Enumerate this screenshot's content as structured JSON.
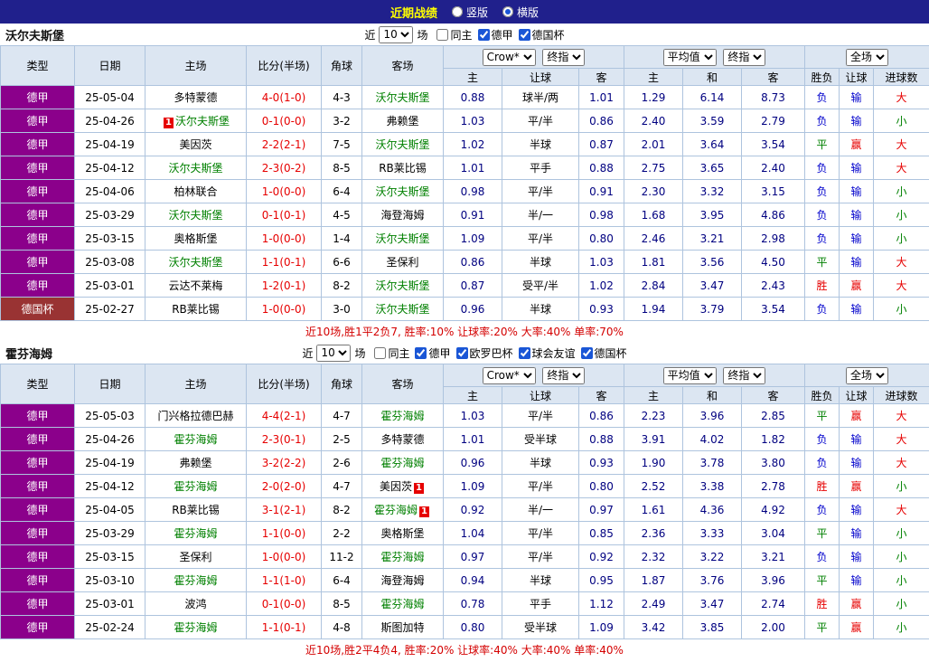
{
  "topbar": {
    "title": "近期战绩",
    "radios": [
      {
        "label": "竖版",
        "selected": false
      },
      {
        "label": "横版",
        "selected": true
      }
    ]
  },
  "colors": {
    "title_bar_bg": "#20208c",
    "title_text": "#ffff00",
    "header_bg": "#dce6f2",
    "border": "#aec4de",
    "league": {
      "德甲": "#8b008b",
      "德国杯": "#993333"
    },
    "focus_team": "#008000",
    "score_text": "#e60000",
    "odds_text": "#000080",
    "result": {
      "win": "#e60000",
      "draw": "#008000",
      "lose": "#0000cc"
    },
    "summary_text": "#d40000",
    "badge_bg": "#e60000"
  },
  "result_map": {
    "胜": "win",
    "平": "draw",
    "负": "lose",
    "赢": "win",
    "输": "lose",
    "大": "win",
    "小": "draw"
  },
  "filter_labels": {
    "prefix": "近",
    "suffix": "场"
  },
  "table_header": {
    "cols": [
      "类型",
      "日期",
      "主场",
      "比分(半场)",
      "角球",
      "客场"
    ],
    "odds_company": "Crow*",
    "odds_stage": "终指",
    "avg_label": "平均值",
    "avg_stage": "终指",
    "scope": "全场",
    "sub_cols": [
      "主",
      "让球",
      "客",
      "主",
      "和",
      "客",
      "胜负",
      "让球",
      "进球数"
    ]
  },
  "sections": [
    {
      "team": "沃尔夫斯堡",
      "filter": {
        "count": "10",
        "checkboxes": [
          {
            "label": "同主",
            "checked": false
          },
          {
            "label": "德甲",
            "checked": true
          },
          {
            "label": "德国杯",
            "checked": true
          }
        ]
      },
      "rows": [
        {
          "league": "德甲",
          "date": "25-05-04",
          "home": "多特蒙德",
          "score": "4-0(1-0)",
          "corner": "4-3",
          "away": "沃尔夫斯堡",
          "away_focus": true,
          "odds_home": "0.88",
          "handicap": "球半/两",
          "odds_away": "1.01",
          "avg_home": "1.29",
          "avg_draw": "6.14",
          "avg_away": "8.73",
          "result": "负",
          "handicap_result": "输",
          "goals": "大"
        },
        {
          "league": "德甲",
          "date": "25-04-26",
          "home": "沃尔夫斯堡",
          "home_focus": true,
          "home_badge": "1",
          "home_badge_pos": "before",
          "score": "0-1(0-0)",
          "corner": "3-2",
          "away": "弗赖堡",
          "odds_home": "1.03",
          "handicap": "平/半",
          "odds_away": "0.86",
          "avg_home": "2.40",
          "avg_draw": "3.59",
          "avg_away": "2.79",
          "result": "负",
          "handicap_result": "输",
          "goals": "小"
        },
        {
          "league": "德甲",
          "date": "25-04-19",
          "home": "美因茨",
          "score": "2-2(2-1)",
          "corner": "7-5",
          "away": "沃尔夫斯堡",
          "away_focus": true,
          "odds_home": "1.02",
          "handicap": "半球",
          "odds_away": "0.87",
          "avg_home": "2.01",
          "avg_draw": "3.64",
          "avg_away": "3.54",
          "result": "平",
          "handicap_result": "赢",
          "goals": "大"
        },
        {
          "league": "德甲",
          "date": "25-04-12",
          "home": "沃尔夫斯堡",
          "home_focus": true,
          "score": "2-3(0-2)",
          "corner": "8-5",
          "away": "RB莱比锡",
          "odds_home": "1.01",
          "handicap": "平手",
          "odds_away": "0.88",
          "avg_home": "2.75",
          "avg_draw": "3.65",
          "avg_away": "2.40",
          "result": "负",
          "handicap_result": "输",
          "goals": "大"
        },
        {
          "league": "德甲",
          "date": "25-04-06",
          "home": "柏林联合",
          "score": "1-0(0-0)",
          "corner": "6-4",
          "away": "沃尔夫斯堡",
          "away_focus": true,
          "odds_home": "0.98",
          "handicap": "平/半",
          "odds_away": "0.91",
          "avg_home": "2.30",
          "avg_draw": "3.32",
          "avg_away": "3.15",
          "result": "负",
          "handicap_result": "输",
          "goals": "小"
        },
        {
          "league": "德甲",
          "date": "25-03-29",
          "home": "沃尔夫斯堡",
          "home_focus": true,
          "score": "0-1(0-1)",
          "corner": "4-5",
          "away": "海登海姆",
          "odds_home": "0.91",
          "handicap": "半/一",
          "odds_away": "0.98",
          "avg_home": "1.68",
          "avg_draw": "3.95",
          "avg_away": "4.86",
          "result": "负",
          "handicap_result": "输",
          "goals": "小"
        },
        {
          "league": "德甲",
          "date": "25-03-15",
          "home": "奥格斯堡",
          "score": "1-0(0-0)",
          "corner": "1-4",
          "away": "沃尔夫斯堡",
          "away_focus": true,
          "odds_home": "1.09",
          "handicap": "平/半",
          "odds_away": "0.80",
          "avg_home": "2.46",
          "avg_draw": "3.21",
          "avg_away": "2.98",
          "result": "负",
          "handicap_result": "输",
          "goals": "小"
        },
        {
          "league": "德甲",
          "date": "25-03-08",
          "home": "沃尔夫斯堡",
          "home_focus": true,
          "score": "1-1(0-1)",
          "corner": "6-6",
          "away": "圣保利",
          "odds_home": "0.86",
          "handicap": "半球",
          "odds_away": "1.03",
          "avg_home": "1.81",
          "avg_draw": "3.56",
          "avg_away": "4.50",
          "result": "平",
          "handicap_result": "输",
          "goals": "大"
        },
        {
          "league": "德甲",
          "date": "25-03-01",
          "home": "云达不莱梅",
          "score": "1-2(0-1)",
          "corner": "8-2",
          "away": "沃尔夫斯堡",
          "away_focus": true,
          "odds_home": "0.87",
          "handicap": "受平/半",
          "odds_away": "1.02",
          "avg_home": "2.84",
          "avg_draw": "3.47",
          "avg_away": "2.43",
          "result": "胜",
          "handicap_result": "赢",
          "goals": "大"
        },
        {
          "league": "德国杯",
          "date": "25-02-27",
          "home": "RB莱比锡",
          "score": "1-0(0-0)",
          "corner": "3-0",
          "away": "沃尔夫斯堡",
          "away_focus": true,
          "odds_home": "0.96",
          "handicap": "半球",
          "odds_away": "0.93",
          "avg_home": "1.94",
          "avg_draw": "3.79",
          "avg_away": "3.54",
          "result": "负",
          "handicap_result": "输",
          "goals": "小"
        }
      ],
      "summary": "近10场,胜1平2负7, 胜率:10% 让球率:20% 大率:40% 单率:70%"
    },
    {
      "team": "霍芬海姆",
      "filter": {
        "count": "10",
        "checkboxes": [
          {
            "label": "同主",
            "checked": false
          },
          {
            "label": "德甲",
            "checked": true
          },
          {
            "label": "欧罗巴杯",
            "checked": true
          },
          {
            "label": "球会友谊",
            "checked": true
          },
          {
            "label": "德国杯",
            "checked": true
          }
        ]
      },
      "rows": [
        {
          "league": "德甲",
          "date": "25-05-03",
          "home": "门兴格拉德巴赫",
          "score": "4-4(2-1)",
          "corner": "4-7",
          "away": "霍芬海姆",
          "away_focus": true,
          "odds_home": "1.03",
          "handicap": "平/半",
          "odds_away": "0.86",
          "avg_home": "2.23",
          "avg_draw": "3.96",
          "avg_away": "2.85",
          "result": "平",
          "handicap_result": "赢",
          "goals": "大"
        },
        {
          "league": "德甲",
          "date": "25-04-26",
          "home": "霍芬海姆",
          "home_focus": true,
          "score": "2-3(0-1)",
          "corner": "2-5",
          "away": "多特蒙德",
          "odds_home": "1.01",
          "handicap": "受半球",
          "odds_away": "0.88",
          "avg_home": "3.91",
          "avg_draw": "4.02",
          "avg_away": "1.82",
          "result": "负",
          "handicap_result": "输",
          "goals": "大"
        },
        {
          "league": "德甲",
          "date": "25-04-19",
          "home": "弗赖堡",
          "score": "3-2(2-2)",
          "corner": "2-6",
          "away": "霍芬海姆",
          "away_focus": true,
          "odds_home": "0.96",
          "handicap": "半球",
          "odds_away": "0.93",
          "avg_home": "1.90",
          "avg_draw": "3.78",
          "avg_away": "3.80",
          "result": "负",
          "handicap_result": "输",
          "goals": "大"
        },
        {
          "league": "德甲",
          "date": "25-04-12",
          "home": "霍芬海姆",
          "home_focus": true,
          "score": "2-0(2-0)",
          "corner": "4-7",
          "away": "美因茨",
          "away_badge": "1",
          "away_badge_pos": "after",
          "odds_home": "1.09",
          "handicap": "平/半",
          "odds_away": "0.80",
          "avg_home": "2.52",
          "avg_draw": "3.38",
          "avg_away": "2.78",
          "result": "胜",
          "handicap_result": "赢",
          "goals": "小"
        },
        {
          "league": "德甲",
          "date": "25-04-05",
          "home": "RB莱比锡",
          "score": "3-1(2-1)",
          "corner": "8-2",
          "away": "霍芬海姆",
          "away_focus": true,
          "away_badge": "1",
          "away_badge_pos": "after",
          "odds_home": "0.92",
          "handicap": "半/一",
          "odds_away": "0.97",
          "avg_home": "1.61",
          "avg_draw": "4.36",
          "avg_away": "4.92",
          "result": "负",
          "handicap_result": "输",
          "goals": "大"
        },
        {
          "league": "德甲",
          "date": "25-03-29",
          "home": "霍芬海姆",
          "home_focus": true,
          "score": "1-1(0-0)",
          "corner": "2-2",
          "away": "奥格斯堡",
          "odds_home": "1.04",
          "handicap": "平/半",
          "odds_away": "0.85",
          "avg_home": "2.36",
          "avg_draw": "3.33",
          "avg_away": "3.04",
          "result": "平",
          "handicap_result": "输",
          "goals": "小"
        },
        {
          "league": "德甲",
          "date": "25-03-15",
          "home": "圣保利",
          "score": "1-0(0-0)",
          "corner": "11-2",
          "away": "霍芬海姆",
          "away_focus": true,
          "odds_home": "0.97",
          "handicap": "平/半",
          "odds_away": "0.92",
          "avg_home": "2.32",
          "avg_draw": "3.22",
          "avg_away": "3.21",
          "result": "负",
          "handicap_result": "输",
          "goals": "小"
        },
        {
          "league": "德甲",
          "date": "25-03-10",
          "home": "霍芬海姆",
          "home_focus": true,
          "score": "1-1(1-0)",
          "corner": "6-4",
          "away": "海登海姆",
          "odds_home": "0.94",
          "handicap": "半球",
          "odds_away": "0.95",
          "avg_home": "1.87",
          "avg_draw": "3.76",
          "avg_away": "3.96",
          "result": "平",
          "handicap_result": "输",
          "goals": "小"
        },
        {
          "league": "德甲",
          "date": "25-03-01",
          "home": "波鸿",
          "score": "0-1(0-0)",
          "corner": "8-5",
          "away": "霍芬海姆",
          "away_focus": true,
          "odds_home": "0.78",
          "handicap": "平手",
          "odds_away": "1.12",
          "avg_home": "2.49",
          "avg_draw": "3.47",
          "avg_away": "2.74",
          "result": "胜",
          "handicap_result": "赢",
          "goals": "小"
        },
        {
          "league": "德甲",
          "date": "25-02-24",
          "home": "霍芬海姆",
          "home_focus": true,
          "score": "1-1(0-1)",
          "corner": "4-8",
          "away": "斯图加特",
          "odds_home": "0.80",
          "handicap": "受半球",
          "odds_away": "1.09",
          "avg_home": "3.42",
          "avg_draw": "3.85",
          "avg_away": "2.00",
          "result": "平",
          "handicap_result": "赢",
          "goals": "小"
        }
      ],
      "summary": "近10场,胜2平4负4, 胜率:20% 让球率:40% 大率:40% 单率:40%"
    }
  ]
}
